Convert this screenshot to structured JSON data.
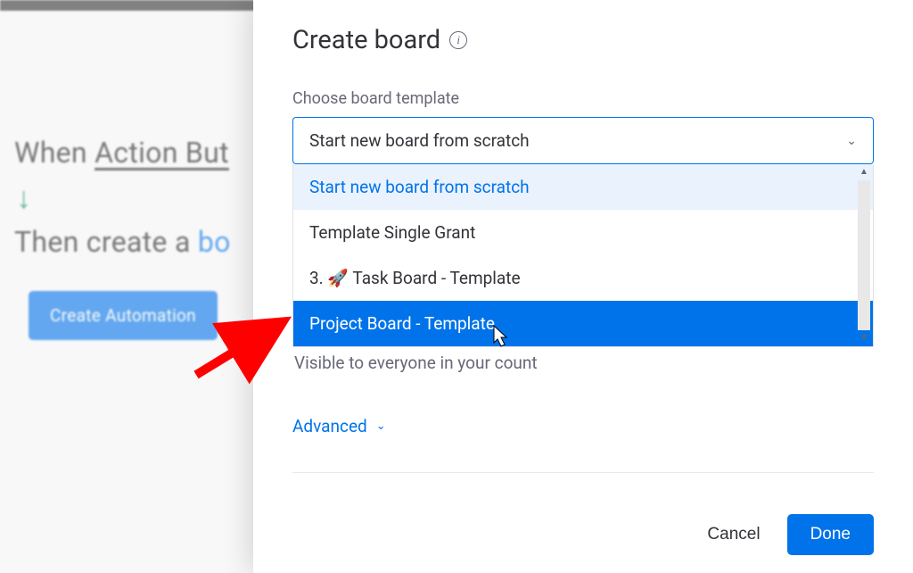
{
  "background": {
    "line1_when": "When ",
    "line1_action": "Action But",
    "arrow_glyph": "↓",
    "line2_then": "Then create a ",
    "line2_link": "bo",
    "create_button": "Create Automation"
  },
  "modal": {
    "title": "Create board",
    "field_label": "Choose board template",
    "select_value": "Start new board from scratch",
    "options": [
      {
        "label": "Start new board from scratch",
        "state": "selected"
      },
      {
        "label": "Template Single Grant",
        "state": "normal"
      },
      {
        "label": "3. 🚀 Task Board - Template",
        "state": "normal"
      },
      {
        "label": "Project Board - Template",
        "state": "highlighted"
      }
    ],
    "visibility_text": "Visible to everyone in your     count",
    "advanced_label": "Advanced",
    "cancel_label": "Cancel",
    "done_label": "Done"
  }
}
